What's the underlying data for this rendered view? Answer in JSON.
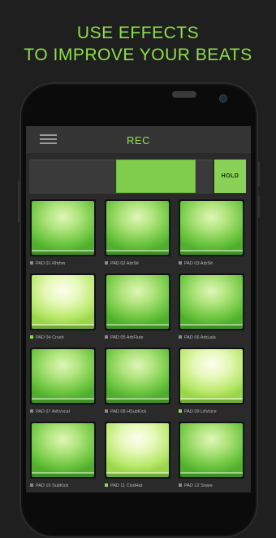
{
  "promo": {
    "line1": "USE EFFECTS",
    "line2": "TO IMPROVE YOUR BEATS"
  },
  "appbar": {
    "menu_icon": "hamburger-menu-icon",
    "title": "REC"
  },
  "effects": {
    "hold_label": "HOLD",
    "fill_level": 0.43
  },
  "pads": [
    {
      "label": "PAD 01 Rhthm",
      "active": false
    },
    {
      "label": "PAD 02 ArbSit",
      "active": false
    },
    {
      "label": "PAD 03 ArbSit",
      "active": false
    },
    {
      "label": "PAD 04 Crush",
      "active": true
    },
    {
      "label": "PAD 05 ArbFlute",
      "active": false
    },
    {
      "label": "PAD 06 ArbLala",
      "active": false
    },
    {
      "label": "PAD 07 ArbVocal",
      "active": false
    },
    {
      "label": "PAD 08 HSubKick",
      "active": false
    },
    {
      "label": "PAD 09 LdVoice",
      "active": true
    },
    {
      "label": "PAD 10 SubKick",
      "active": false
    },
    {
      "label": "PAD 11 ClsdHat",
      "active": true
    },
    {
      "label": "PAD 12 Snare",
      "active": false
    }
  ],
  "colors": {
    "accent": "#8ee04a",
    "background": "#1f1f1f",
    "pad_green": "#6cc53f",
    "pad_bright": "#e6f8b8"
  }
}
